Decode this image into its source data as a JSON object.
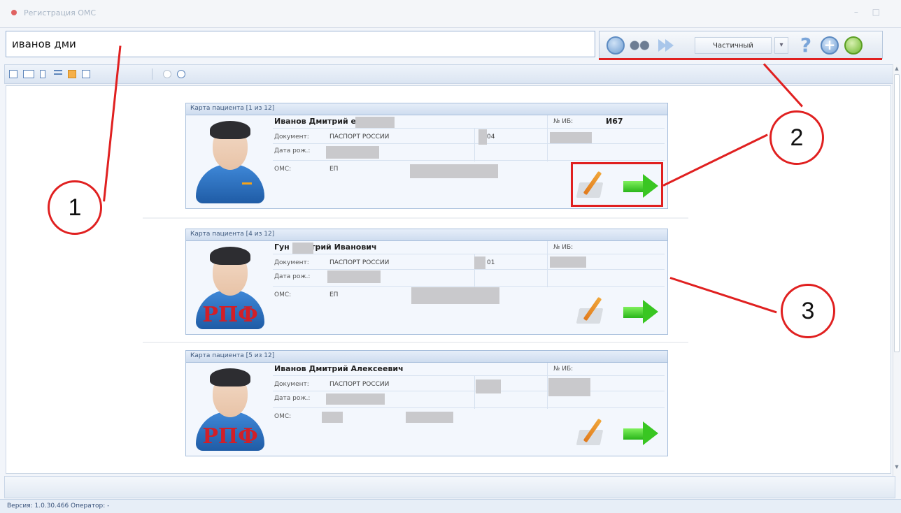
{
  "window": {
    "title": "Регистрация ОМС",
    "controls": "– □"
  },
  "search": {
    "value": "иванов дми"
  },
  "toolbar": {
    "mode": "Частичный",
    "dropdown": "▾",
    "help": "?",
    "add": "+"
  },
  "card_labels": {
    "document": "Документ:",
    "birth_date": "Дата рож.:",
    "oms": "ОМС:",
    "ib": "№ ИБ:"
  },
  "cards": [
    {
      "header": "Карта пациента [1 из 12]",
      "name": "Иванов Дмитрий         евич",
      "doc_type": "ПАСПОРТ РОССИИ",
      "doc_num": "04",
      "oms_type": "ЕП",
      "ib_value": "И67",
      "avatar_badge": ""
    },
    {
      "header": "Карта пациента [4 из 12]",
      "name": "Гун       Дмитрий Иванович",
      "doc_type": "ПАСПОРТ РОССИИ",
      "doc_num": "01",
      "oms_type": "ЕП",
      "ib_value": "",
      "avatar_badge": "РПФ"
    },
    {
      "header": "Карта пациента [5 из 12]",
      "name": "Иванов Дмитрий Алексеевич",
      "doc_type": "ПАСПОРТ РОССИИ",
      "doc_num": "",
      "oms_type": "",
      "ib_value": "",
      "avatar_badge": "РПФ"
    }
  ],
  "annotations": [
    "1",
    "2",
    "3"
  ],
  "status": {
    "text": "Версия: 1.0.30.466   Оператор: -"
  },
  "colors": {
    "annotation": "#e02020",
    "accent": "#5e86bb"
  }
}
